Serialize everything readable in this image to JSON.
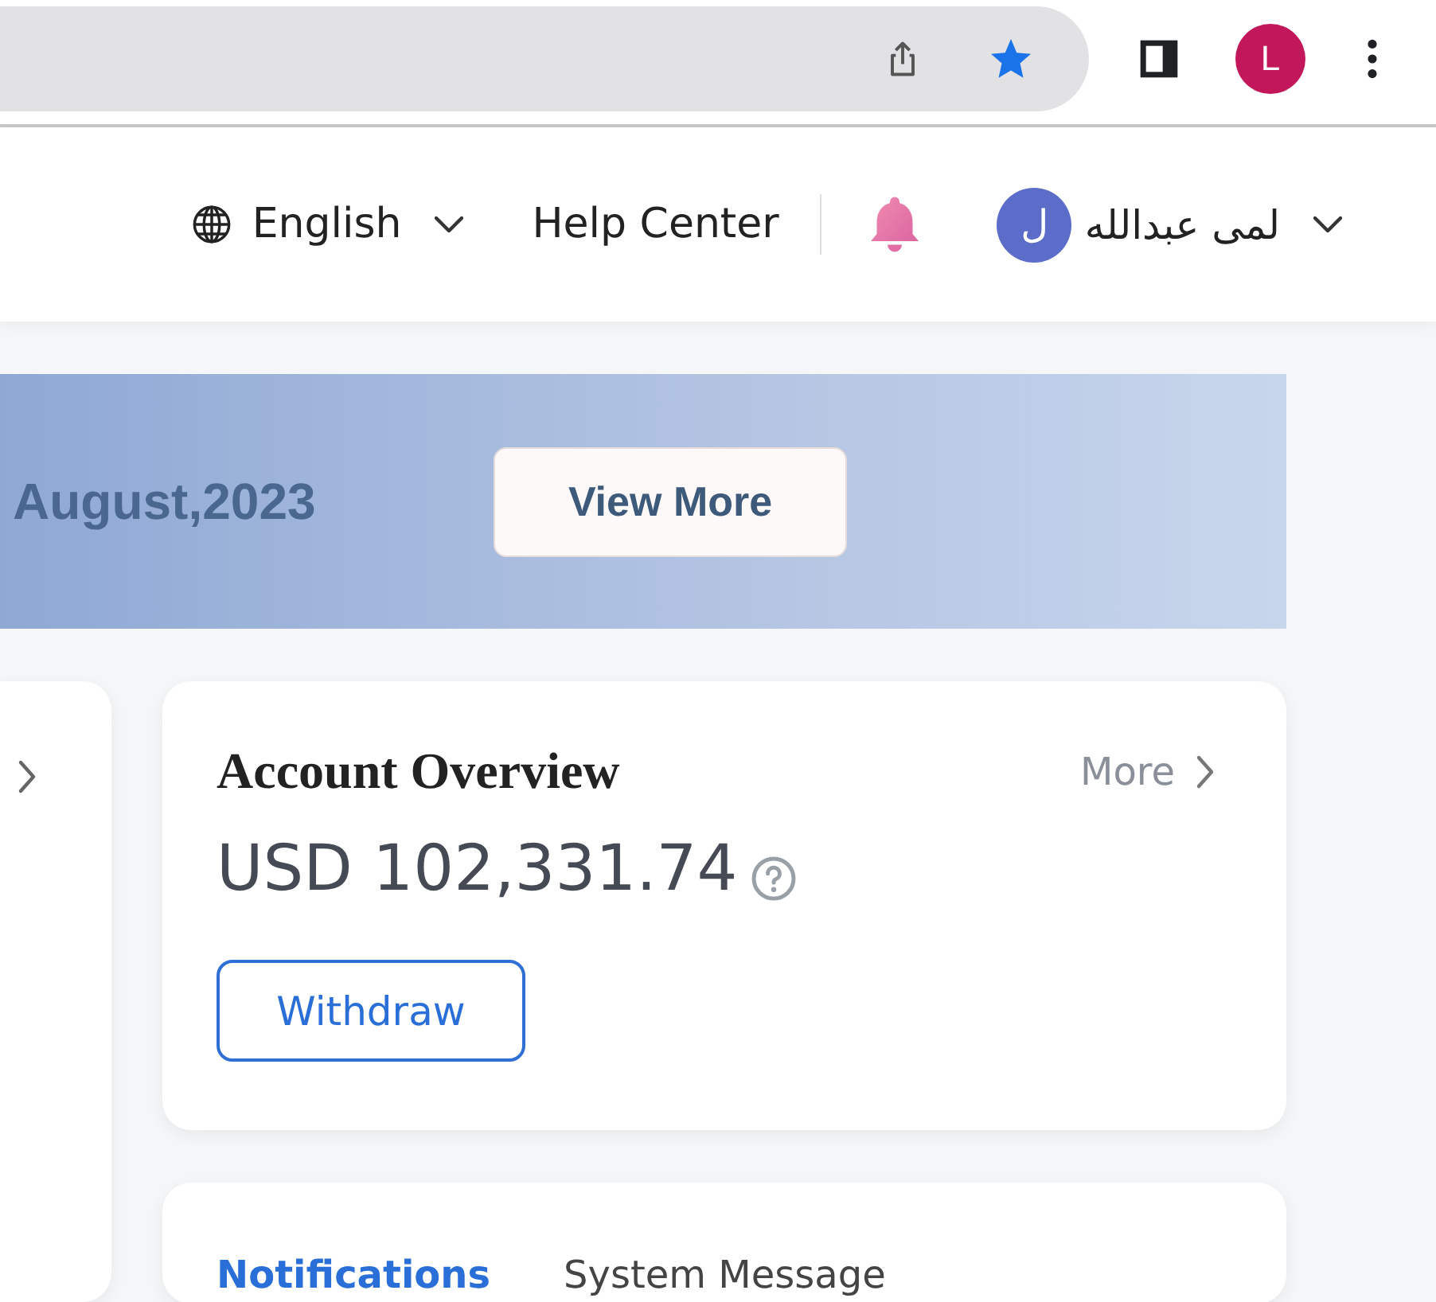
{
  "browser": {
    "profile_initial": "L"
  },
  "header": {
    "language": "English",
    "help": "Help Center",
    "user": {
      "avatar_initial": "ل",
      "name": "لمى عبدالله"
    }
  },
  "banner": {
    "date": "August,2023",
    "button": "View More"
  },
  "account": {
    "title": "Account Overview",
    "more": "More",
    "balance": "USD 102,331.74",
    "button": "Withdraw"
  },
  "tabs": [
    {
      "label": "Notifications",
      "selected": true
    },
    {
      "label": "System Message",
      "selected": false
    }
  ]
}
